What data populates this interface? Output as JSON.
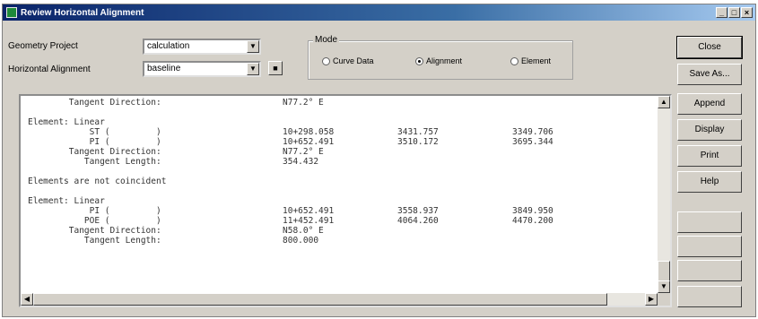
{
  "window": {
    "title": "Review Horizontal Alignment",
    "controls": [
      "_",
      "□",
      "×"
    ]
  },
  "form": {
    "geometry_project_label": "Geometry Project",
    "geometry_project_value": "calculation",
    "horizontal_alignment_label": "Horizontal Alignment",
    "horizontal_alignment_value": "baseline"
  },
  "mode": {
    "title": "Mode",
    "options": [
      {
        "label": "Curve Data",
        "selected": false
      },
      {
        "label": "Alignment",
        "selected": true
      },
      {
        "label": "Element",
        "selected": false
      }
    ]
  },
  "report": {
    "lines": [
      [
        "        Tangent Direction:",
        "N77.2° E",
        "",
        ""
      ],
      [
        "",
        "",
        "",
        ""
      ],
      [
        "Element: Linear",
        "",
        "",
        ""
      ],
      [
        "            ST (         )",
        "10+298.058",
        "3431.757",
        "3349.706"
      ],
      [
        "            PI (         )",
        "10+652.491",
        "3510.172",
        "3695.344"
      ],
      [
        "        Tangent Direction:",
        "N77.2° E",
        "",
        ""
      ],
      [
        "           Tangent Length:",
        "354.432",
        "",
        ""
      ],
      [
        "",
        "",
        "",
        ""
      ],
      [
        "Elements are not coincident",
        "",
        "",
        ""
      ],
      [
        "",
        "",
        "",
        ""
      ],
      [
        "Element: Linear",
        "",
        "",
        ""
      ],
      [
        "            PI (         )",
        "10+652.491",
        "3558.937",
        "3849.950"
      ],
      [
        "           POE (         )",
        "11+452.491",
        "4064.260",
        "4470.200"
      ],
      [
        "        Tangent Direction:",
        "N58.0° E",
        "",
        ""
      ],
      [
        "           Tangent Length:",
        "800.000",
        "",
        ""
      ]
    ]
  },
  "buttons": [
    {
      "label": "Close",
      "enabled": true
    },
    {
      "label": "Save As...",
      "enabled": true
    },
    {
      "label": "Append",
      "enabled": true
    },
    {
      "label": "Display",
      "enabled": true
    },
    {
      "label": "Print",
      "enabled": true
    },
    {
      "label": "Help",
      "enabled": true
    },
    {
      "label": "",
      "enabled": false
    },
    {
      "label": "",
      "enabled": false
    },
    {
      "label": "",
      "enabled": false
    },
    {
      "label": "",
      "enabled": false
    }
  ]
}
